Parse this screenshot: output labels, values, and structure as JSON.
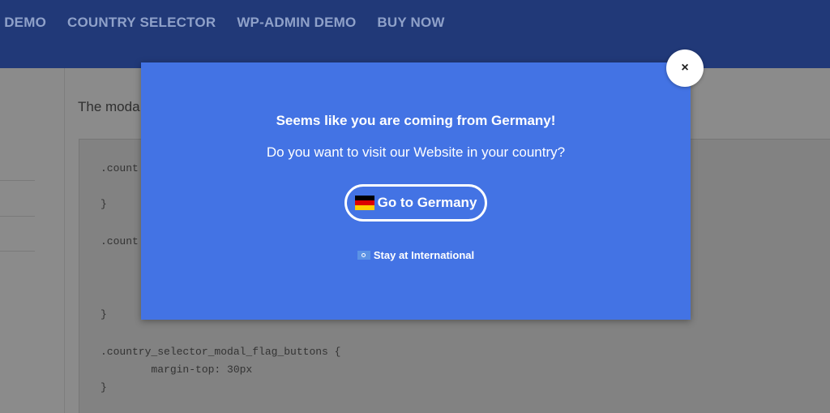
{
  "nav": {
    "items": [
      "L DEMO",
      "COUNTRY SELECTOR",
      "WP-ADMIN DEMO",
      "BUY NOW"
    ]
  },
  "page": {
    "intro": "The moda",
    "code_lines": [
      ".count",
      "}",
      ".count",
      "}",
      ".country_selector_modal_flag_buttons {",
      "        margin-top: 30px",
      "}"
    ]
  },
  "modal": {
    "heading": "Seems like you are coming from Germany!",
    "question": "Do you want to visit our Website in your country?",
    "primary_label": "Go to Germany",
    "primary_icon": "germany-flag-icon",
    "secondary_label": "Stay at International",
    "secondary_icon": "un-flag-icon",
    "close_symbol": "×",
    "background_color": "#4373e4"
  },
  "colors": {
    "nav_bg": "#213978",
    "modal_bg": "#4373e4",
    "overlay": "#8a8a8a"
  }
}
